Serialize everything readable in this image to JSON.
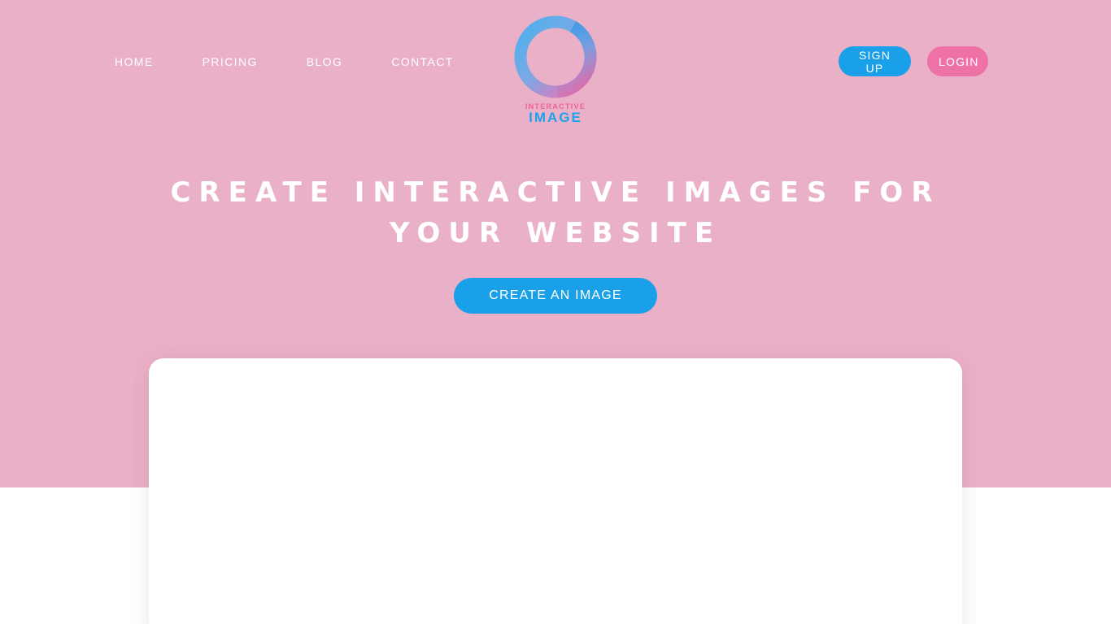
{
  "nav": {
    "links": [
      {
        "label": "HOME"
      },
      {
        "label": "PRICING"
      },
      {
        "label": "BLOG"
      },
      {
        "label": "CONTACT"
      }
    ],
    "signup_label": "SIGN UP",
    "login_label": "LOGIN"
  },
  "logo": {
    "icon": "ring-logo-icon",
    "top_text": "INTERACTIVE",
    "bottom_text": "IMAGE"
  },
  "hero": {
    "headline_line1": "CREATE INTERACTIVE IMAGES FOR",
    "headline_line2": "YOUR WEBSITE",
    "cta_label": "CREATE AN IMAGE"
  },
  "colors": {
    "hero_background": "#e9b0c7",
    "primary_blue": "#1aa0e8",
    "accent_pink": "#ef72a6",
    "white": "#ffffff"
  }
}
